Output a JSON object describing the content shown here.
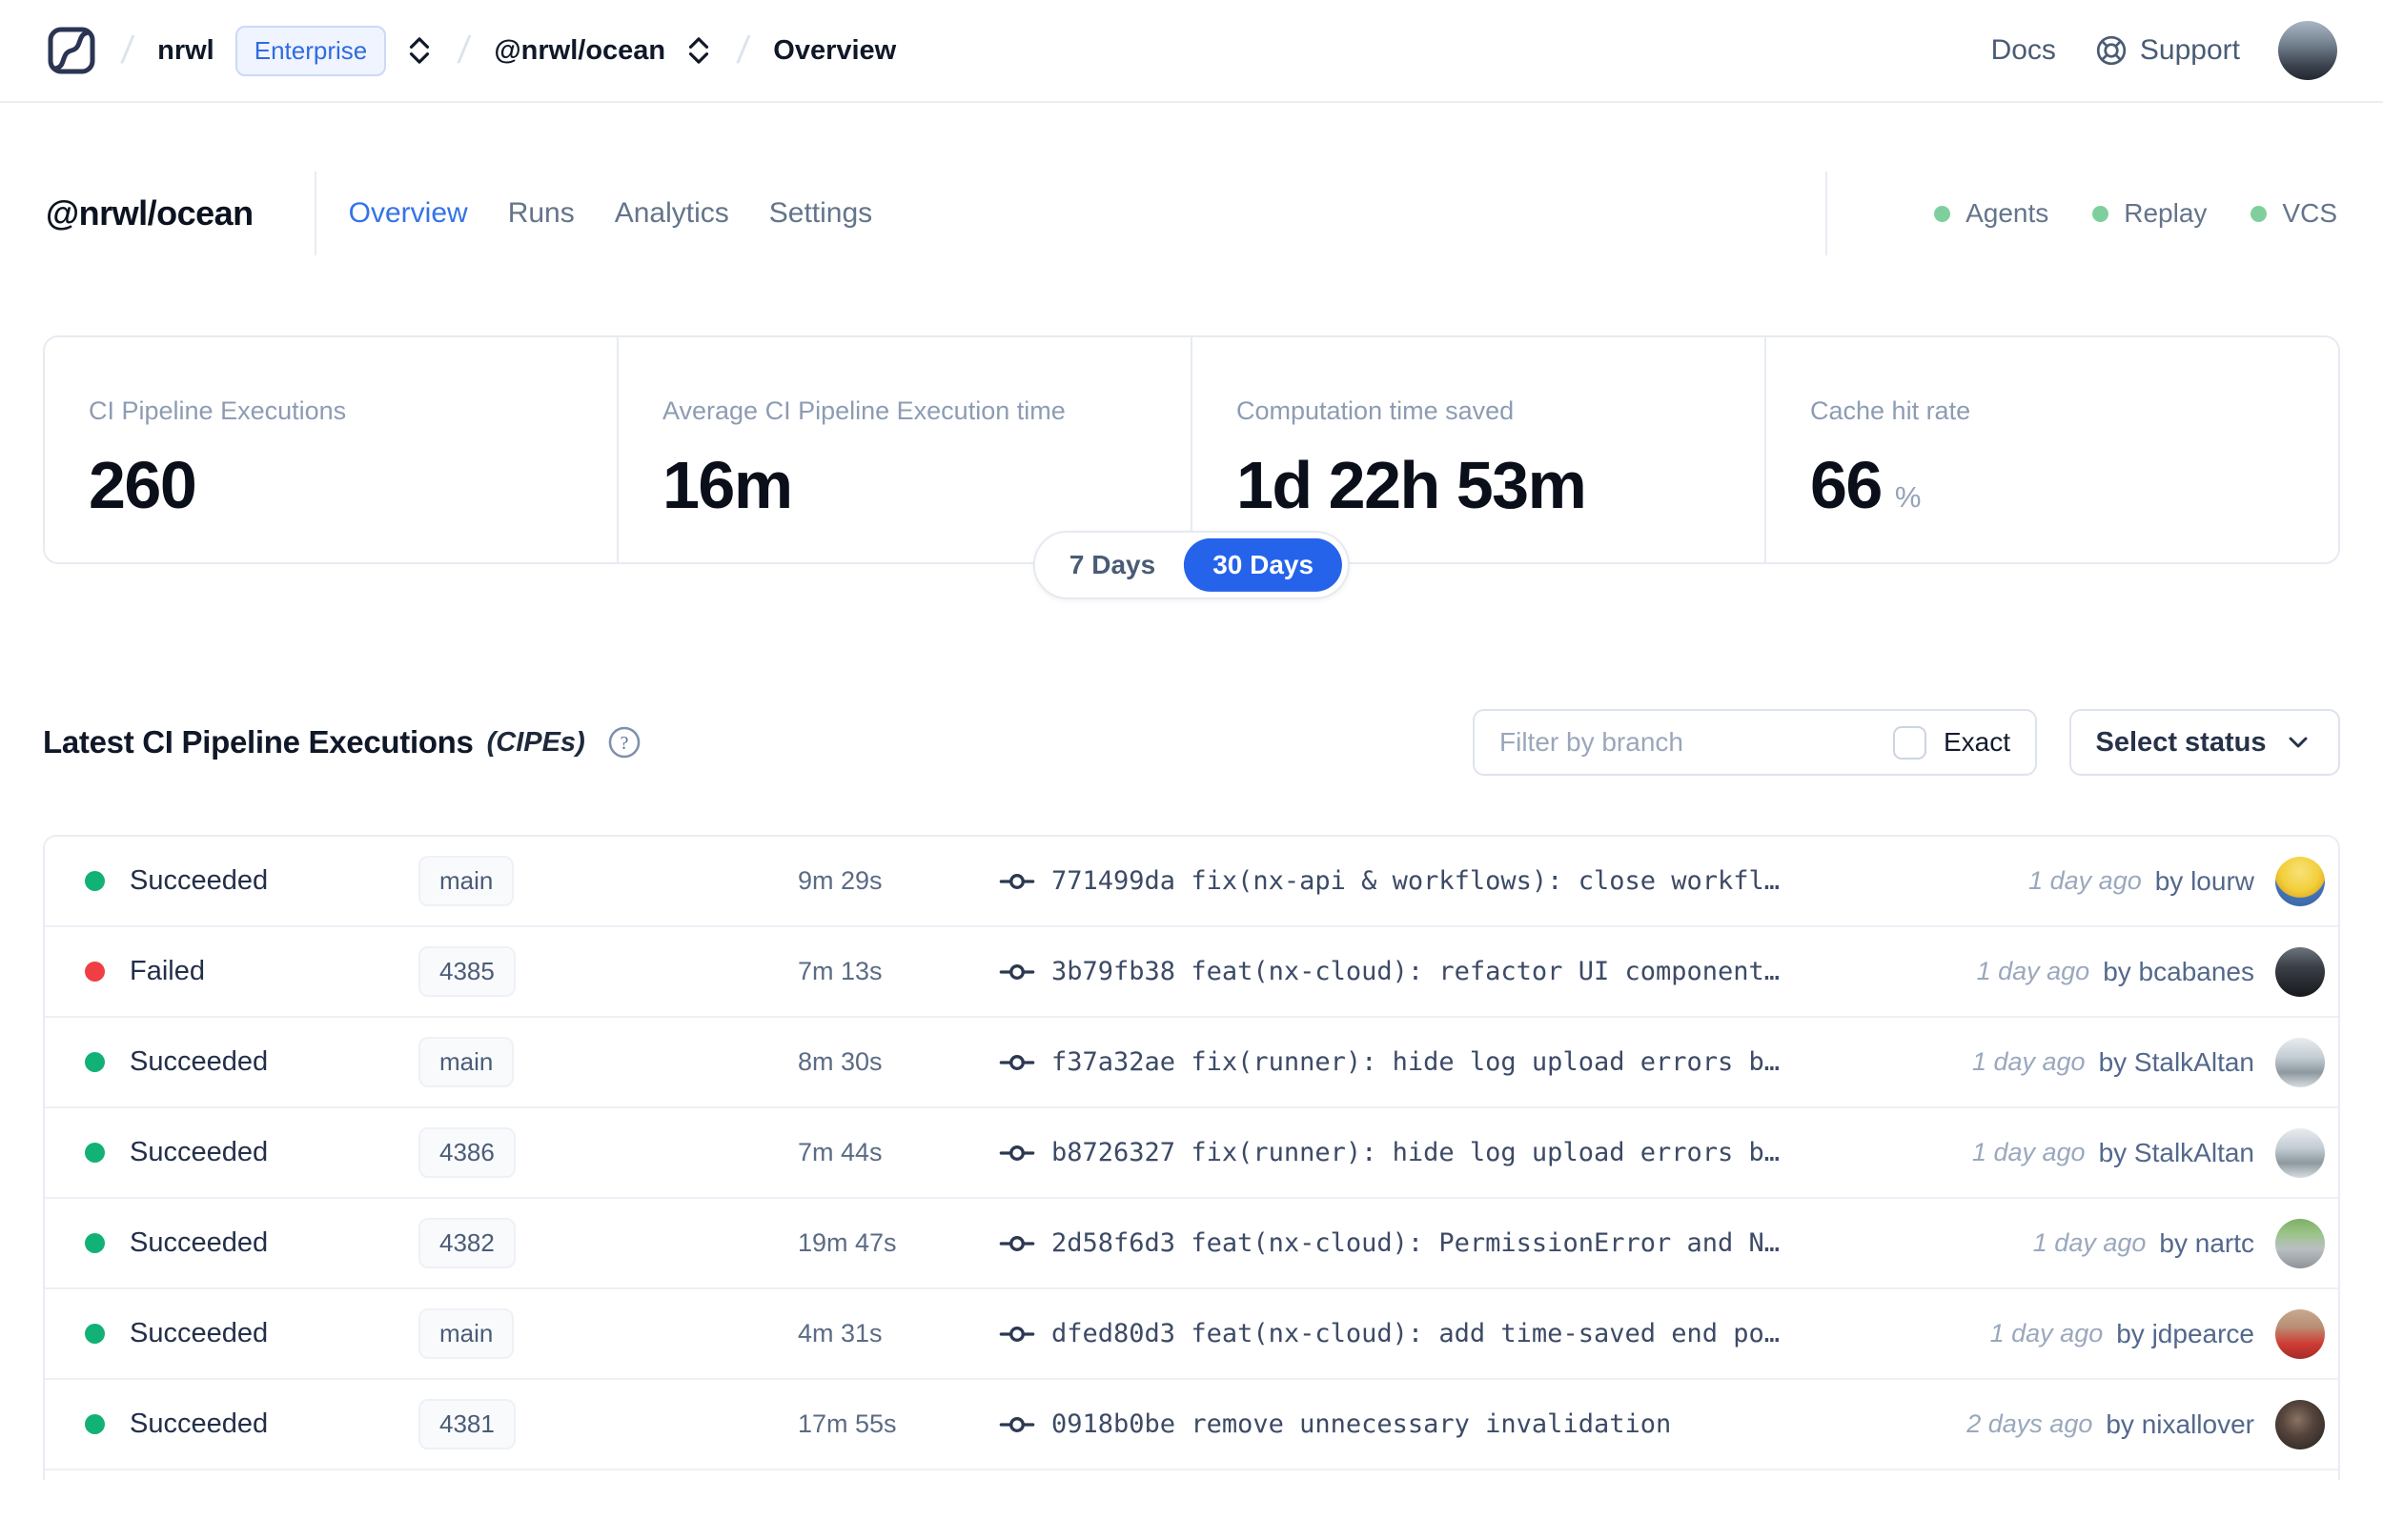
{
  "topnav": {
    "org": "nrwl",
    "enterprise_badge": "Enterprise",
    "workspace": "@nrwl/ocean",
    "page": "Overview",
    "docs": "Docs",
    "support": "Support"
  },
  "header": {
    "workspace_title": "@nrwl/ocean",
    "tabs": [
      {
        "label": "Overview",
        "active": true
      },
      {
        "label": "Runs",
        "active": false
      },
      {
        "label": "Analytics",
        "active": false
      },
      {
        "label": "Settings",
        "active": false
      }
    ],
    "statuses": [
      {
        "label": "Agents"
      },
      {
        "label": "Replay"
      },
      {
        "label": "VCS"
      }
    ]
  },
  "stats": {
    "cards": [
      {
        "label": "CI Pipeline Executions",
        "value": "260",
        "unit": ""
      },
      {
        "label": "Average CI Pipeline Execution time",
        "value": "16m",
        "unit": ""
      },
      {
        "label": "Computation time saved",
        "value": "1d 22h 53m",
        "unit": ""
      },
      {
        "label": "Cache hit rate",
        "value": "66",
        "unit": "%"
      }
    ],
    "range_toggle": {
      "options": [
        "7 Days",
        "30 Days"
      ],
      "selected": "30 Days"
    }
  },
  "cipes": {
    "title": "Latest CI Pipeline Executions",
    "title_suffix": "(CIPEs)",
    "help_glyph": "?",
    "filter_placeholder": "Filter by branch",
    "exact_label": "Exact",
    "status_dropdown_label": "Select status",
    "rows": [
      {
        "status": "Succeeded",
        "branch": "main",
        "duration": "9m 29s",
        "commit": "771499da",
        "message": "fix(nx-api & workflows): close workfl…",
        "time": "1 day ago",
        "author": "by lourw"
      },
      {
        "status": "Failed",
        "branch": "4385",
        "duration": "7m 13s",
        "commit": "3b79fb38",
        "message": "feat(nx-cloud): refactor UI component…",
        "time": "1 day ago",
        "author": "by bcabanes"
      },
      {
        "status": "Succeeded",
        "branch": "main",
        "duration": "8m 30s",
        "commit": "f37a32ae",
        "message": "fix(runner): hide log upload errors b…",
        "time": "1 day ago",
        "author": "by StalkAltan"
      },
      {
        "status": "Succeeded",
        "branch": "4386",
        "duration": "7m 44s",
        "commit": "b8726327",
        "message": "fix(runner): hide log upload errors b…",
        "time": "1 day ago",
        "author": "by StalkAltan"
      },
      {
        "status": "Succeeded",
        "branch": "4382",
        "duration": "19m 47s",
        "commit": "2d58f6d3",
        "message": "feat(nx-cloud): PermissionError and N…",
        "time": "1 day ago",
        "author": "by nartc"
      },
      {
        "status": "Succeeded",
        "branch": "main",
        "duration": "4m 31s",
        "commit": "dfed80d3",
        "message": "feat(nx-cloud): add time-saved end po…",
        "time": "1 day ago",
        "author": "by jdpearce"
      },
      {
        "status": "Succeeded",
        "branch": "4381",
        "duration": "17m 55s",
        "commit": "0918b0be",
        "message": "remove unnecessary invalidation",
        "time": "2 days ago",
        "author": "by nixallover"
      }
    ]
  },
  "colors": {
    "accent_blue": "#2563eb",
    "active_tab_blue": "#3473e8",
    "success_green": "#12b176",
    "failure_red": "#ef3f44",
    "service_dot_green": "#7fcf9d"
  }
}
